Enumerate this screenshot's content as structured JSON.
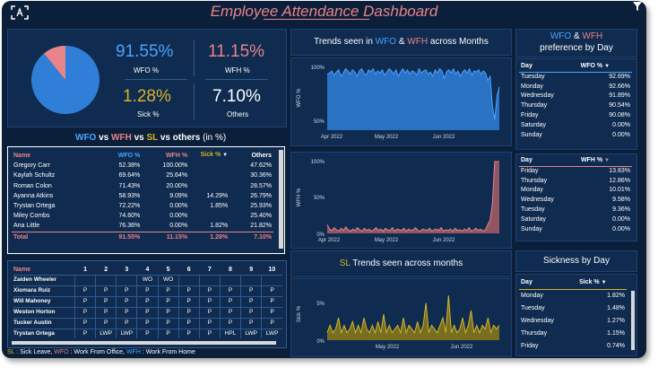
{
  "header": {
    "title": "Employee Attendance Dashboard",
    "logo_icon": "logo-icon",
    "filter_icon": "funnel-icon"
  },
  "kpis": {
    "wfo": {
      "value": "91.55%",
      "label": "WFO %"
    },
    "wfh": {
      "value": "11.15%",
      "label": "WFH %"
    },
    "sick": {
      "value": "1.28%",
      "label": "Sick %"
    },
    "others": {
      "value": "7.10%",
      "label": "Others"
    }
  },
  "pie": {
    "wfo_share": 0.8915,
    "wfh_share": 0.1085,
    "wfo_color": "#2f7fd8",
    "wfh_color": "#e8848a"
  },
  "comparison": {
    "title_parts": [
      "WFO",
      "vs",
      "WFH",
      "vs",
      "SL",
      "vs others",
      "(in %)"
    ],
    "headers": [
      "Name",
      "WFO %",
      "WFH %",
      "Sick %",
      "Others"
    ],
    "rows": [
      [
        "Gregory Carr",
        "52.38%",
        "100.00%",
        "",
        "47.62%"
      ],
      [
        "Kaylah Schultz",
        "69.64%",
        "25.64%",
        "",
        "30.36%"
      ],
      [
        "Roman Colon",
        "71.43%",
        "20.00%",
        "",
        "28.57%"
      ],
      [
        "Ayanna Atkins",
        "58.93%",
        "9.09%",
        "14.29%",
        "26.79%"
      ],
      [
        "Trystan Ortega",
        "72.22%",
        "0.00%",
        "1.85%",
        "25.93%"
      ],
      [
        "Miley Combs",
        "74.60%",
        "0.00%",
        "",
        "25.40%"
      ],
      [
        "Ana Little",
        "76.36%",
        "0.00%",
        "1.82%",
        "21.82%"
      ]
    ],
    "total": [
      "Total",
      "91.55%",
      "11.15%",
      "1.28%",
      "7.10%"
    ]
  },
  "attendance": {
    "headers": [
      "Name",
      "1",
      "2",
      "3",
      "4",
      "5",
      "6",
      "7",
      "8",
      "9",
      "10"
    ],
    "rows": [
      [
        "Zaiden Wheeler",
        "",
        "",
        "",
        "WO",
        "WO",
        "",
        "",
        "",
        "",
        ""
      ],
      [
        "Xiomara Ruiz",
        "P",
        "P",
        "P",
        "P",
        "P",
        "P",
        "P",
        "P",
        "P",
        "P"
      ],
      [
        "Will Mahoney",
        "P",
        "P",
        "P",
        "P",
        "P",
        "P",
        "P",
        "P",
        "P",
        "P"
      ],
      [
        "Weston Horton",
        "P",
        "P",
        "P",
        "P",
        "P",
        "P",
        "P",
        "P",
        "P",
        "P"
      ],
      [
        "Tucker Austin",
        "P",
        "P",
        "P",
        "P",
        "P",
        "P",
        "P",
        "P",
        "P",
        "P"
      ],
      [
        "Trystan Ortega",
        "P",
        "LWP",
        "LWP",
        "P",
        "P",
        "P",
        "P",
        "HPL",
        "LWP",
        "LWP"
      ]
    ]
  },
  "legend": {
    "sl": "SL",
    "sl_text": ": Sick Leave,",
    "wfo": "WFO",
    "wfo_text": ": Work From Office,",
    "wfh": "WFH",
    "wfh_text": ": Work From Home"
  },
  "trends": {
    "title_a": "Trends seen in",
    "wfo": "WFO",
    "amp": "&",
    "wfh": "WFH",
    "title_b": "across Months",
    "wfo_chart": {
      "ylabel": "WFO %",
      "yticks": [
        "100%",
        "50%"
      ],
      "xticks": [
        "Apr 2022",
        "May 2022",
        "Jun 2022"
      ],
      "chart_data": {
        "type": "area",
        "ylim": [
          40,
          100
        ],
        "values": [
          92,
          93,
          95,
          91,
          94,
          96,
          90,
          93,
          97,
          95,
          92,
          96,
          94,
          90,
          95,
          97,
          93,
          91,
          96,
          94,
          97,
          92,
          95,
          93,
          96,
          91,
          94,
          97,
          95,
          92,
          96,
          90,
          94,
          97,
          93,
          96,
          92,
          95,
          94,
          91,
          97,
          93,
          95,
          96,
          92,
          94,
          90,
          96,
          93,
          97,
          95,
          88,
          94,
          96,
          93,
          97,
          92,
          95,
          90,
          94,
          96,
          93,
          97,
          91,
          95,
          94,
          96,
          92,
          95,
          93,
          86,
          90,
          62,
          50,
          72,
          80
        ],
        "color": "#2f7fd8"
      }
    },
    "wfh_chart": {
      "ylabel": "WFH %",
      "yticks": [
        "100%",
        "50%",
        "0%"
      ],
      "xticks": [
        "Apr 2022",
        "May 2022",
        "Jun 2022"
      ],
      "chart_data": {
        "type": "area",
        "ylim": [
          0,
          100
        ],
        "values": [
          12,
          6,
          4,
          8,
          5,
          3,
          7,
          4,
          9,
          5,
          3,
          6,
          4,
          8,
          5,
          3,
          7,
          4,
          6,
          3,
          5,
          8,
          4,
          6,
          3,
          7,
          5,
          4,
          8,
          3,
          6,
          5,
          4,
          7,
          3,
          6,
          4,
          5,
          8,
          4,
          3,
          6,
          5,
          4,
          7,
          3,
          5,
          6,
          4,
          8,
          3,
          5,
          4,
          6,
          3,
          7,
          4,
          5,
          3,
          6,
          4,
          8,
          3,
          5,
          7,
          4,
          6,
          3,
          5,
          12,
          18,
          40,
          100,
          100,
          100
        ],
        "color": "#a85e66"
      }
    }
  },
  "sl_trends": {
    "title_sl": "SL",
    "title_rest": "Trends seen across months",
    "ylabel": "Sick %",
    "yticks": [
      "5%",
      "0%"
    ],
    "xticks": [
      "May 2022",
      "Jun 2022"
    ],
    "chart_data": {
      "type": "area",
      "ylim": [
        0,
        7
      ],
      "values": [
        1,
        2,
        1,
        1.5,
        3,
        1,
        2,
        1,
        1.5,
        2.5,
        1,
        2,
        1,
        3,
        1.5,
        1,
        2,
        1,
        2.5,
        1,
        3.5,
        1,
        2,
        1,
        1.5,
        2,
        1,
        3,
        1,
        2,
        1.5,
        1,
        2.5,
        1,
        2,
        5,
        1,
        2,
        1.5,
        1,
        2,
        3,
        1,
        6,
        1,
        2,
        1,
        1.5,
        3,
        1,
        2,
        4,
        1,
        2,
        1,
        2,
        1.5,
        3,
        1,
        2,
        1.5,
        2
      ],
      "color": "#8a7a16"
    }
  },
  "wfo_day": {
    "title_wfo": "WFO",
    "amp": "&",
    "title_wfh": "WFH",
    "subtitle": "preference by Day",
    "headers": [
      "Day",
      "WFO %"
    ],
    "rows": [
      [
        "Tuesday",
        "92.69%"
      ],
      [
        "Monday",
        "92.66%"
      ],
      [
        "Wednesday",
        "91.89%"
      ],
      [
        "Thursday",
        "90.54%"
      ],
      [
        "Friday",
        "90.08%"
      ],
      [
        "Saturday",
        "0.00%"
      ],
      [
        "Sunday",
        "0.00%"
      ]
    ]
  },
  "wfh_day": {
    "headers": [
      "Day",
      "WFH %"
    ],
    "rows": [
      [
        "Friday",
        "13.83%"
      ],
      [
        "Thursday",
        "12.86%"
      ],
      [
        "Monday",
        "10.01%"
      ],
      [
        "Wednesday",
        "9.58%"
      ],
      [
        "Tuesday",
        "9.36%"
      ],
      [
        "Saturday",
        "0.00%"
      ],
      [
        "Sunday",
        "0.00%"
      ]
    ]
  },
  "sick_day": {
    "title": "Sickness by Day",
    "headers": [
      "Day",
      "Sick %"
    ],
    "rows": [
      [
        "Monday",
        "1.82%"
      ],
      [
        "Tuesday",
        "1.48%"
      ],
      [
        "Wednesday",
        "1.27%"
      ],
      [
        "Thursday",
        "1.15%"
      ],
      [
        "Friday",
        "0.74%"
      ]
    ]
  }
}
